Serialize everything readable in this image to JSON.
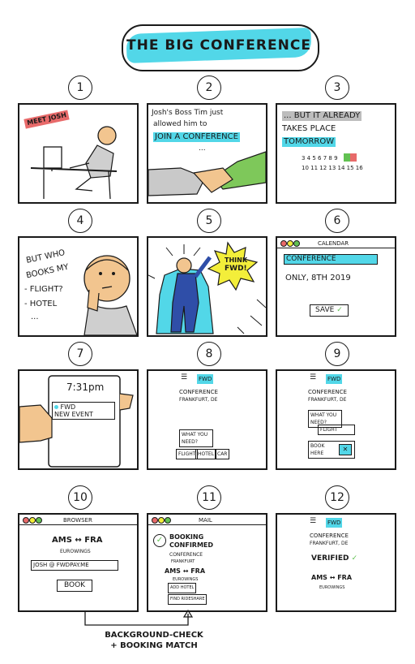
{
  "title": "THE BIG CONFERENCE",
  "panel_numbers": [
    "1",
    "2",
    "3",
    "4",
    "5",
    "6",
    "7",
    "8",
    "9",
    "10",
    "11",
    "12"
  ],
  "p1": {
    "badge": "MEET JOSH"
  },
  "p2": {
    "line1": "Josh's Boss Tim just",
    "line2": "allowed him to",
    "line3": "JOIN A CONFERENCE",
    "line4": "..."
  },
  "p3": {
    "line1": "... BUT IT ALREADY",
    "line2": "TAKES PLACE",
    "line3": "TOMORROW",
    "cal1": "3 4 5 6 7 8 9",
    "cal2": "10 11 12 13 14 15 16"
  },
  "p4": {
    "line1": "BUT WHO",
    "line2": "BOOKS MY",
    "line3": "- FLIGHT?",
    "line4": "- HOTEL",
    "line5": "..."
  },
  "p5": {
    "burst1": "THINK",
    "burst2": "FWD!"
  },
  "p6": {
    "window_title": "CALENDAR",
    "event": "CONFERENCE",
    "date": "ONLY, 8TH 2019",
    "save": "SAVE"
  },
  "p7": {
    "time": "7:31pm",
    "app": "FWD",
    "notice": "NEW EVENT"
  },
  "p8": {
    "logo": "FWD",
    "event": "CONFERENCE",
    "place": "FRANKFURT, DE",
    "prompt1": "WHAT YOU",
    "prompt2": "NEED?",
    "opt1": "FLIGHT",
    "opt2": "HOTEL",
    "opt3": "CAR"
  },
  "p9": {
    "logo": "FWD",
    "event": "CONFERENCE",
    "place": "FRANKFURT, DE",
    "prompt1": "WHAT YOU",
    "prompt2": "NEED?",
    "choice": "FLIGHT",
    "book1": "BOOK",
    "book2": "HERE"
  },
  "p10": {
    "window_title": "BROWSER",
    "route": "AMS ↔ FRA",
    "airline": "EUROWINGS",
    "email": "JOSH @ FWDPAY.ME",
    "book": "BOOK"
  },
  "p11": {
    "window_title": "MAIL",
    "line1": "BOOKING",
    "line2": "CONFIRMED",
    "event": "CONFERENCE",
    "place": "FRANKFURT",
    "route": "AMS ↔ FRA",
    "airline": "EUROWINGS",
    "add_hotel": "ADD HOTEL",
    "find_rides": "FIND RIDESHARE"
  },
  "p12": {
    "logo": "FWD",
    "event": "CONFERENCE",
    "place": "FRANKFURT, DE",
    "status": "VERIFIED",
    "route": "AMS ↔ FRA",
    "airline": "EUROWINGS"
  },
  "caption": {
    "line1": "BACKGROUND-CHECK",
    "line2": "+ BOOKING MATCH"
  },
  "colors": {
    "cyan": "#52d7e8",
    "yellow": "#f3ee3a",
    "green": "#62c152",
    "pink": "#e86a6a",
    "blue": "#2f4ea8",
    "skin": "#f2c58f",
    "gray": "#bdbdbd"
  }
}
